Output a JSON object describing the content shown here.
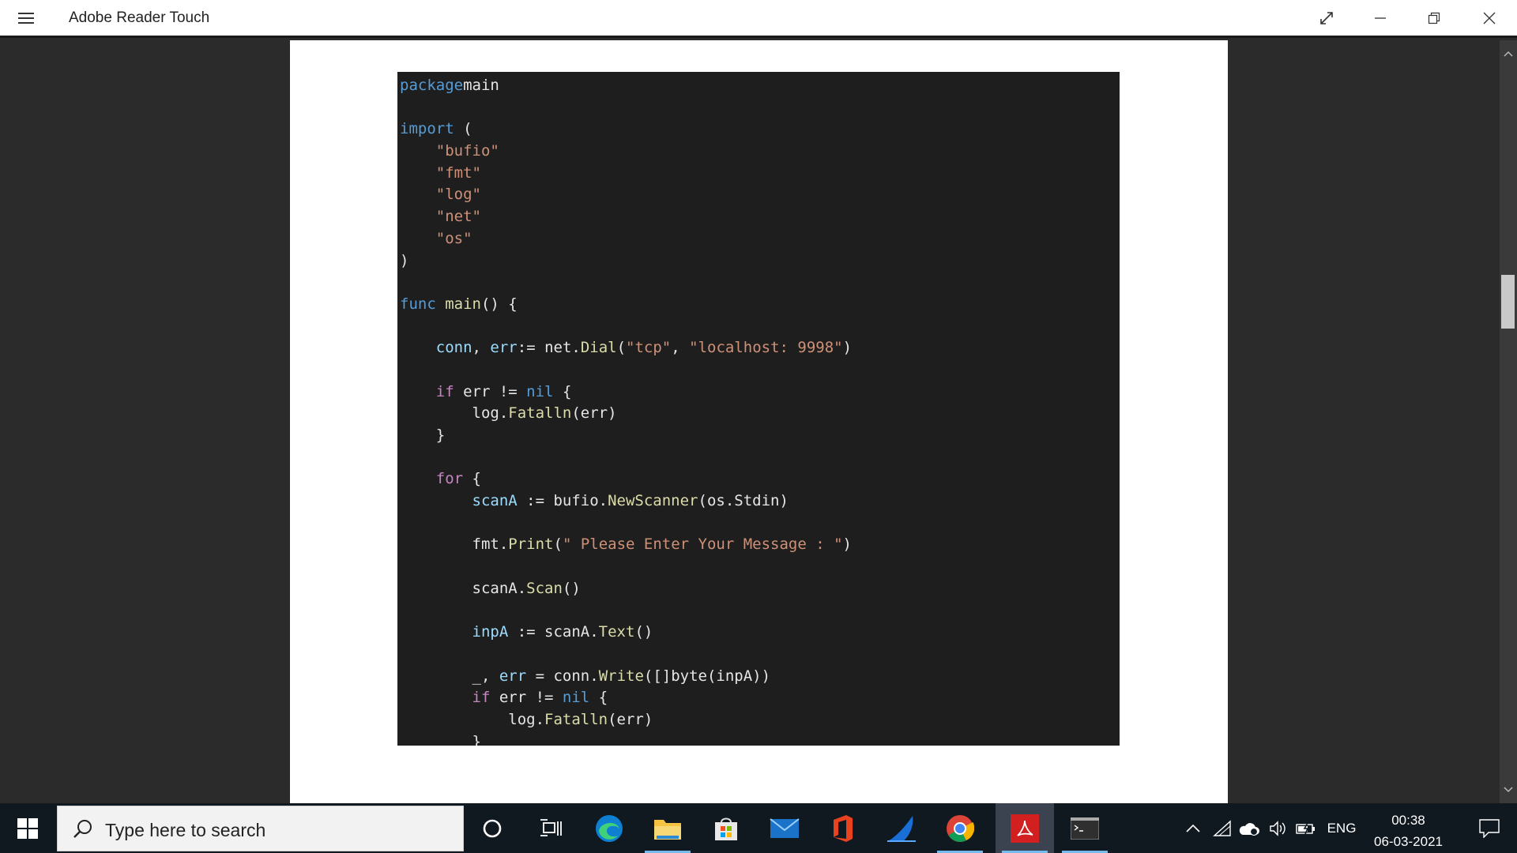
{
  "window": {
    "title": "Adobe Reader Touch"
  },
  "document": {
    "code_lines": [
      [
        [
          "kw",
          "package"
        ],
        [
          "",
          "main"
        ]
      ],
      [],
      [
        [
          "kw",
          "import"
        ],
        [
          "",
          " ("
        ]
      ],
      [
        [
          "",
          ""
        ],
        [
          "str",
          "    \"bufio\""
        ]
      ],
      [
        [
          "str",
          "    \"fmt\""
        ]
      ],
      [
        [
          "str",
          "    \"log\""
        ]
      ],
      [
        [
          "str",
          "    \"net\""
        ]
      ],
      [
        [
          "str",
          "    \"os\""
        ]
      ],
      [
        [
          "",
          ")"
        ]
      ],
      [],
      [
        [
          "kw",
          "func"
        ],
        [
          "",
          " "
        ],
        [
          "fn",
          "main"
        ],
        [
          "",
          "() {"
        ]
      ],
      [],
      [
        [
          "",
          "    "
        ],
        [
          "var",
          "conn"
        ],
        [
          "",
          ", "
        ],
        [
          "var",
          "err"
        ],
        [
          "",
          ":= net."
        ],
        [
          "fn",
          "Dial"
        ],
        [
          "",
          "("
        ],
        [
          "str",
          "\"tcp\""
        ],
        [
          "",
          ", "
        ],
        [
          "str",
          "\"localhost: 9998\""
        ],
        [
          "",
          ")"
        ]
      ],
      [],
      [
        [
          "",
          "    "
        ],
        [
          "kw2",
          "if"
        ],
        [
          "",
          "",
          " err != "
        ],
        [
          "kw",
          "nil"
        ],
        [
          "",
          " {"
        ]
      ],
      [
        [
          "",
          "        log."
        ],
        [
          "fn",
          "Fatalln"
        ],
        [
          "",
          "(err)"
        ]
      ],
      [
        [
          "",
          "    }"
        ]
      ],
      [],
      [
        [
          "",
          "    "
        ],
        [
          "kw2",
          "for"
        ],
        [
          "",
          " {"
        ]
      ],
      [
        [
          "",
          "        "
        ],
        [
          "var",
          "scanA"
        ],
        [
          "",
          " := bufio."
        ],
        [
          "fn",
          "NewScanner"
        ],
        [
          "",
          "(os.Stdin)"
        ]
      ],
      [],
      [
        [
          "",
          "        fmt."
        ],
        [
          "fn",
          "Print"
        ],
        [
          "",
          "("
        ],
        [
          "str",
          "\" Please Enter Your Message : \""
        ],
        [
          "",
          ")"
        ]
      ],
      [],
      [
        [
          "",
          "        scanA."
        ],
        [
          "fn",
          "Scan"
        ],
        [
          "",
          "()"
        ]
      ],
      [],
      [
        [
          "",
          "        "
        ],
        [
          "var",
          "inpA"
        ],
        [
          "",
          " := scanA."
        ],
        [
          "fn",
          "Text"
        ],
        [
          "",
          "()"
        ]
      ],
      [],
      [
        [
          "",
          "        _, "
        ],
        [
          "var",
          "err"
        ],
        [
          "",
          " = conn."
        ],
        [
          "fn",
          "Write"
        ],
        [
          "",
          "([]byte(inpA))"
        ]
      ],
      [
        [
          "",
          "        "
        ],
        [
          "kw2",
          "if"
        ],
        [
          "",
          " err != "
        ],
        [
          "kw",
          "nil"
        ],
        [
          "",
          " {"
        ]
      ],
      [
        [
          "",
          "            log."
        ],
        [
          "fn",
          "Fatalln"
        ],
        [
          "",
          "(err)"
        ]
      ],
      [
        [
          "",
          "        }"
        ]
      ]
    ]
  },
  "taskbar": {
    "search_placeholder": "Type here to search",
    "apps": [
      "cortana-icon",
      "task-view-icon",
      "edge-icon",
      "file-explorer-icon",
      "store-icon",
      "mail-icon",
      "office-icon",
      "wireshark-icon",
      "chrome-icon",
      "adobe-reader-icon",
      "command-prompt-icon"
    ],
    "language": "ENG",
    "time": "00:38",
    "date": "06-03-2021"
  },
  "colors": {
    "code_bg": "#1e1e1e",
    "keyword": "#569cd6",
    "control_keyword": "#c586c0",
    "string": "#ce9178",
    "variable": "#9cdcfe",
    "function": "#dcdcaa",
    "taskbar": "#101820"
  }
}
